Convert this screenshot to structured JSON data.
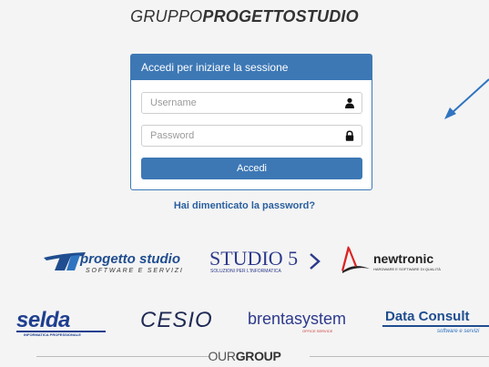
{
  "brand": {
    "prefix": "GRUPPO",
    "name": "PROGETTOSTUDIO"
  },
  "login": {
    "header": "Accedi per iniziare la sessione",
    "username_placeholder": "Username",
    "password_placeholder": "Password",
    "submit_label": "Accedi",
    "forgot_label": "Hai dimenticato la password?"
  },
  "partners": {
    "progetto_studio": {
      "name": "progetto studio",
      "tagline": "SOFTWARE E SERVIZI"
    },
    "studio5": {
      "name": "STUDIO 5",
      "tagline": "SOLUZIONI PER L'INFORMATICA"
    },
    "newtronic": {
      "name": "newtronic",
      "tagline": "HARDWARE E SOFTWARE DI QUALITÀ"
    },
    "selda": {
      "name": "selda",
      "tagline": "INFORMATICA PROFESSIONALE"
    },
    "cesio": {
      "name": "CESIO"
    },
    "brentasystem": {
      "name": "brentasystem",
      "tagline": "OFFICE SERVICE"
    },
    "data_consult": {
      "name": "Data Consult",
      "tagline": "software e servizi"
    }
  },
  "footer": {
    "prefix": "OUR",
    "suffix": "GROUP"
  },
  "colors": {
    "primary": "#3d78b5",
    "link": "#2a5f9e"
  }
}
